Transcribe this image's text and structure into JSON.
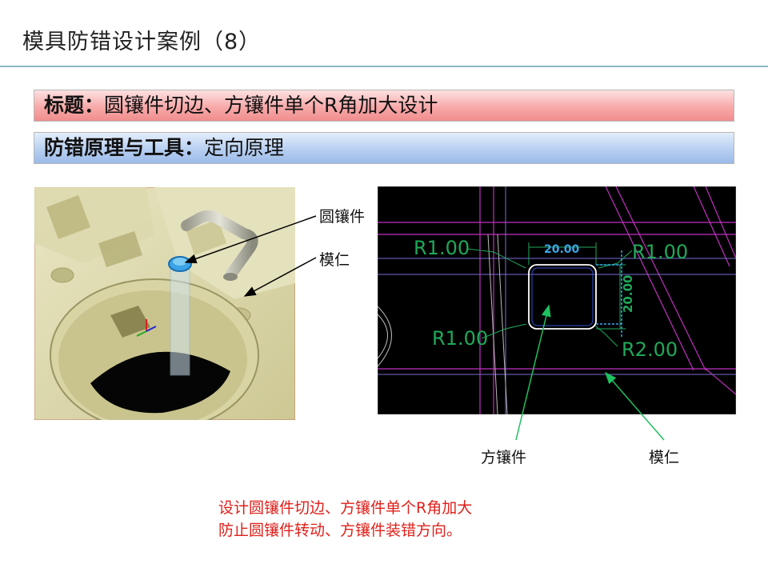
{
  "title": "模具防错设计案例（8）",
  "bar1": {
    "label": "标题：",
    "text": "圆镶件切边、方镶件单个R角加大设计"
  },
  "bar2": {
    "label": "防错原理与工具：",
    "text": "定向原理"
  },
  "left_callouts": {
    "insert": "圆镶件",
    "core": "模仁"
  },
  "right_callouts": {
    "insert": "方镶件",
    "core": "模仁"
  },
  "cad": {
    "r_top_left": "R1.00",
    "r_top_right": "R1.00",
    "r_bottom_left": "R1.00",
    "r_bottom_right": "R2.00",
    "dim_horizontal": "20.00",
    "dim_vertical": "20.00"
  },
  "annotation": {
    "line1": "设计圆镶件切边、方镶件单个R角加大",
    "line2": "防止圆镶件转动、方镶件装错方向。"
  },
  "colors": {
    "annotation": "#e0201a",
    "cad_dim": "#1fa85a",
    "cad_pink": "#c030c0"
  }
}
